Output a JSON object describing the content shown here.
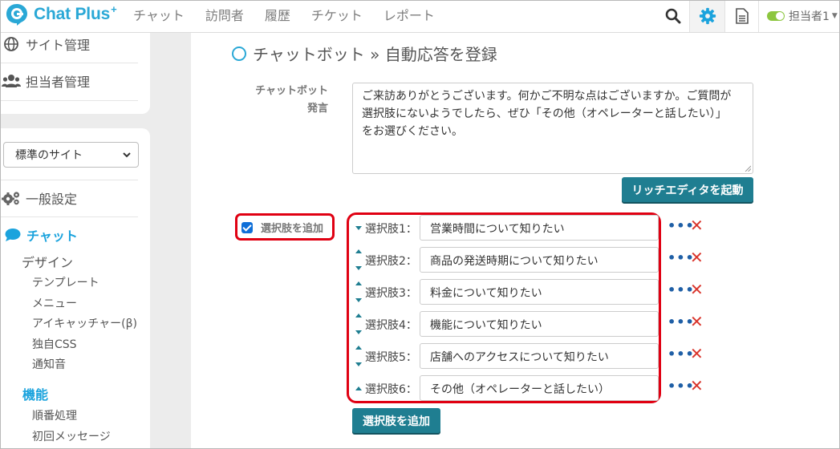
{
  "app": {
    "brand": "Chat Plus",
    "brand_sup": "+"
  },
  "topnav": {
    "menu": [
      "チャット",
      "訪問者",
      "履歴",
      "チケット",
      "レポート"
    ],
    "user": "担当者1"
  },
  "sidebar": {
    "top_items": [
      {
        "label": "サイト管理",
        "icon": "globe-icon"
      },
      {
        "label": "担当者管理",
        "icon": "users-icon"
      }
    ],
    "site_select": "標準のサイト",
    "general": {
      "label": "一般設定",
      "icon": "gears-icon"
    },
    "chat": {
      "label": "チャット",
      "icon": "chat-bubble-icon"
    },
    "design": "デザイン",
    "design_items": [
      "テンプレート",
      "メニュー",
      "アイキャッチャー(β)",
      "独自CSS",
      "通知音"
    ],
    "function": "機能",
    "function_items": [
      "順番処理",
      "初回メッセージ"
    ]
  },
  "main": {
    "title": "チャットボット » 自動応答を登録",
    "bot_label_1": "チャットボット",
    "bot_label_2": "発言",
    "bot_message_lines": [
      "ご来訪ありがとうございます。何かご不明な点はございますか。ご質問が",
      "選択肢にないようでしたら、ぜひ「その他（オペレーターと話したい）」",
      "をお選びください。"
    ],
    "rich_editor_button": "リッチエディタを起動",
    "add_choice_checkbox_label": "選択肢を追加",
    "add_choice_checked": true,
    "choices": [
      {
        "label": "選択肢1：",
        "value": "営業時間について知りたい"
      },
      {
        "label": "選択肢2：",
        "value": "商品の発送時期について知りたい"
      },
      {
        "label": "選択肢3：",
        "value": "料金について知りたい"
      },
      {
        "label": "選択肢4：",
        "value": "機能について知りたい"
      },
      {
        "label": "選択肢5：",
        "value": "店舗へのアクセスについて知りたい"
      },
      {
        "label": "選択肢6：",
        "value": "その他（オペレーターと話したい）"
      }
    ],
    "add_choice_button": "選択肢を追加"
  },
  "colors": {
    "accent": "#2aa8d6",
    "button": "#1f7e91",
    "highlight": "#e00012",
    "delete": "#d9342b"
  }
}
